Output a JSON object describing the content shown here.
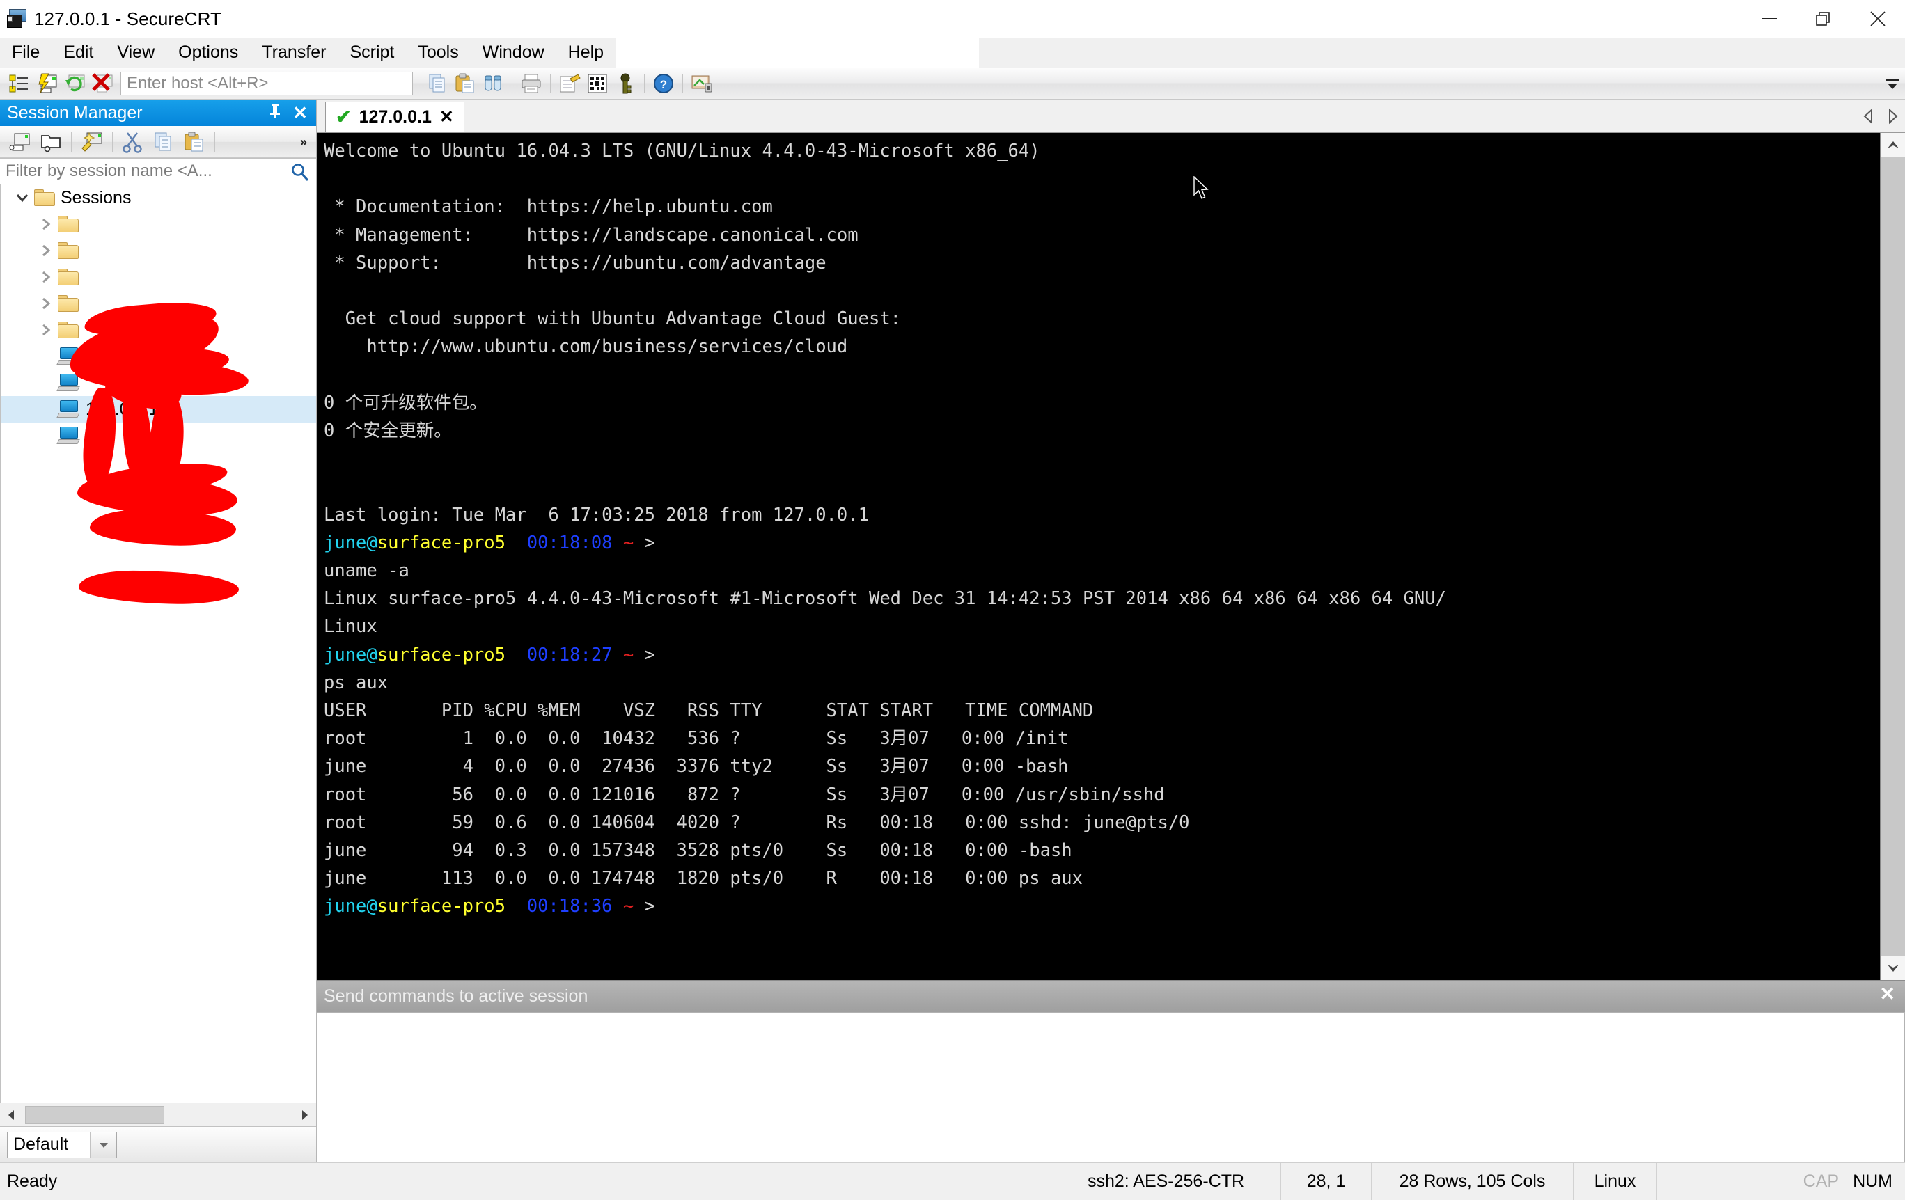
{
  "window": {
    "title": "127.0.0.1 - SecureCRT",
    "app_icon": "securecrt-icon",
    "controls": {
      "minimize": "minimize",
      "maximize": "restore",
      "close": "close"
    }
  },
  "menubar": {
    "items": [
      {
        "label": "File",
        "name": "menu-file"
      },
      {
        "label": "Edit",
        "name": "menu-edit"
      },
      {
        "label": "View",
        "name": "menu-view"
      },
      {
        "label": "Options",
        "name": "menu-options"
      },
      {
        "label": "Transfer",
        "name": "menu-transfer"
      },
      {
        "label": "Script",
        "name": "menu-script"
      },
      {
        "label": "Tools",
        "name": "menu-tools"
      },
      {
        "label": "Window",
        "name": "menu-window"
      },
      {
        "label": "Help",
        "name": "menu-help"
      }
    ]
  },
  "toolbar": {
    "host_placeholder": "Enter host <Alt+R>",
    "host_value": "",
    "overflow_label": "»"
  },
  "session_manager": {
    "title": "Session Manager",
    "pin_glyph": "📌",
    "close_glyph": "✕",
    "filter_placeholder": "Filter by session name <A...",
    "root": {
      "label": "Sessions",
      "expanded": true
    },
    "folders": [
      {
        "label": "",
        "redacted": true
      },
      {
        "label": "",
        "redacted": true
      },
      {
        "label": "",
        "redacted": true
      },
      {
        "label": "",
        "redacted": true
      },
      {
        "label": "",
        "redacted": true
      }
    ],
    "hosts": [
      {
        "label": "",
        "redacted": true,
        "selected": false
      },
      {
        "label": "",
        "redacted": true,
        "selected": false
      },
      {
        "label": "127.0.0.1",
        "redacted": false,
        "selected": true
      },
      {
        "label": "",
        "redacted": true,
        "selected": false
      }
    ],
    "firewall_combo": {
      "value": "Default"
    }
  },
  "tabs": [
    {
      "label": "127.0.0.1",
      "status": "connected",
      "close_glyph": "✕",
      "active": true
    }
  ],
  "tab_nav": {
    "prev": "◁",
    "next": "▷"
  },
  "terminal": {
    "lines": [
      [
        {
          "t": "Welcome to Ubuntu 16.04.3 LTS (GNU/Linux 4.4.0-43-Microsoft x86_64)",
          "c": "white"
        }
      ],
      [
        {
          "t": "",
          "c": "white"
        }
      ],
      [
        {
          "t": " * Documentation:  https://help.ubuntu.com",
          "c": "white"
        }
      ],
      [
        {
          "t": " * Management:     https://landscape.canonical.com",
          "c": "white"
        }
      ],
      [
        {
          "t": " * Support:        https://ubuntu.com/advantage",
          "c": "white"
        }
      ],
      [
        {
          "t": "",
          "c": "white"
        }
      ],
      [
        {
          "t": "  Get cloud support with Ubuntu Advantage Cloud Guest:",
          "c": "white"
        }
      ],
      [
        {
          "t": "    http://www.ubuntu.com/business/services/cloud",
          "c": "white"
        }
      ],
      [
        {
          "t": "",
          "c": "white"
        }
      ],
      [
        {
          "t": "0 个可升级软件包。",
          "c": "white"
        }
      ],
      [
        {
          "t": "0 个安全更新。",
          "c": "white"
        }
      ],
      [
        {
          "t": "",
          "c": "white"
        }
      ],
      [
        {
          "t": "",
          "c": "white"
        }
      ],
      [
        {
          "t": "Last login: Tue Mar  6 17:03:25 2018 from 127.0.0.1",
          "c": "white"
        }
      ],
      [
        {
          "t": "june@",
          "c": "cyan"
        },
        {
          "t": "surface-pro5",
          "c": "yellow"
        },
        {
          "t": "  ",
          "c": "white"
        },
        {
          "t": "00:18:08",
          "c": "blue"
        },
        {
          "t": " ",
          "c": "white"
        },
        {
          "t": "~",
          "c": "red"
        },
        {
          "t": " >",
          "c": "white"
        }
      ],
      [
        {
          "t": "uname -a",
          "c": "white"
        }
      ],
      [
        {
          "t": "Linux surface-pro5 4.4.0-43-Microsoft #1-Microsoft Wed Dec 31 14:42:53 PST 2014 x86_64 x86_64 x86_64 GNU/",
          "c": "white"
        }
      ],
      [
        {
          "t": "Linux",
          "c": "white"
        }
      ],
      [
        {
          "t": "june@",
          "c": "cyan"
        },
        {
          "t": "surface-pro5",
          "c": "yellow"
        },
        {
          "t": "  ",
          "c": "white"
        },
        {
          "t": "00:18:27",
          "c": "blue"
        },
        {
          "t": " ",
          "c": "white"
        },
        {
          "t": "~",
          "c": "red"
        },
        {
          "t": " >",
          "c": "white"
        }
      ],
      [
        {
          "t": "ps aux",
          "c": "white"
        }
      ],
      [
        {
          "t": "USER       PID %CPU %MEM    VSZ   RSS TTY      STAT START   TIME COMMAND",
          "c": "white"
        }
      ],
      [
        {
          "t": "root         1  0.0  0.0  10432   536 ?        Ss   3月07   0:00 /init",
          "c": "white"
        }
      ],
      [
        {
          "t": "june         4  0.0  0.0  27436  3376 tty2     Ss   3月07   0:00 -bash",
          "c": "white"
        }
      ],
      [
        {
          "t": "root        56  0.0  0.0 121016   872 ?        Ss   3月07   0:00 /usr/sbin/sshd",
          "c": "white"
        }
      ],
      [
        {
          "t": "root        59  0.6  0.0 140604  4020 ?        Rs   00:18   0:00 sshd: june@pts/0",
          "c": "white"
        }
      ],
      [
        {
          "t": "june        94  0.3  0.0 157348  3528 pts/0    Ss   00:18   0:00 -bash",
          "c": "white"
        }
      ],
      [
        {
          "t": "june       113  0.0  0.0 174748  1820 pts/0    R    00:18   0:00 ps aux",
          "c": "white"
        }
      ],
      [
        {
          "t": "june@",
          "c": "cyan"
        },
        {
          "t": "surface-pro5",
          "c": "yellow"
        },
        {
          "t": "  ",
          "c": "white"
        },
        {
          "t": "00:18:36",
          "c": "blue"
        },
        {
          "t": " ",
          "c": "white"
        },
        {
          "t": "~",
          "c": "red"
        },
        {
          "t": " >",
          "c": "white"
        }
      ]
    ],
    "ps_table": {
      "headers": [
        "USER",
        "PID",
        "%CPU",
        "%MEM",
        "VSZ",
        "RSS",
        "TTY",
        "STAT",
        "START",
        "TIME",
        "COMMAND"
      ],
      "rows": [
        [
          "root",
          "1",
          "0.0",
          "0.0",
          "10432",
          "536",
          "?",
          "Ss",
          "3月07",
          "0:00",
          "/init"
        ],
        [
          "june",
          "4",
          "0.0",
          "0.0",
          "27436",
          "3376",
          "tty2",
          "Ss",
          "3月07",
          "0:00",
          "-bash"
        ],
        [
          "root",
          "56",
          "0.0",
          "0.0",
          "121016",
          "872",
          "?",
          "Ss",
          "3月07",
          "0:00",
          "/usr/sbin/sshd"
        ],
        [
          "root",
          "59",
          "0.6",
          "0.0",
          "140604",
          "4020",
          "?",
          "Rs",
          "00:18",
          "0:00",
          "sshd: june@pts/0"
        ],
        [
          "june",
          "94",
          "0.3",
          "0.0",
          "157348",
          "3528",
          "pts/0",
          "Ss",
          "00:18",
          "0:00",
          "-bash"
        ],
        [
          "june",
          "113",
          "0.0",
          "0.0",
          "174748",
          "1820",
          "pts/0",
          "R",
          "00:18",
          "0:00",
          "ps aux"
        ]
      ]
    },
    "colors": {
      "background": "#000000",
      "foreground": "#cfcfcf",
      "user": "#22d3ee",
      "host": "#ffff2e",
      "time": "#1e3fff",
      "path": "#e02020"
    }
  },
  "send_commands": {
    "label": "Send commands to active session",
    "close_glyph": "✕",
    "input_value": ""
  },
  "statusbar": {
    "ready": "Ready",
    "cipher": "ssh2: AES-256-CTR",
    "cursor_pos": "28,  1",
    "dimensions": "28 Rows, 105 Cols",
    "emulation": "Linux",
    "cap": "CAP",
    "num": "NUM"
  }
}
